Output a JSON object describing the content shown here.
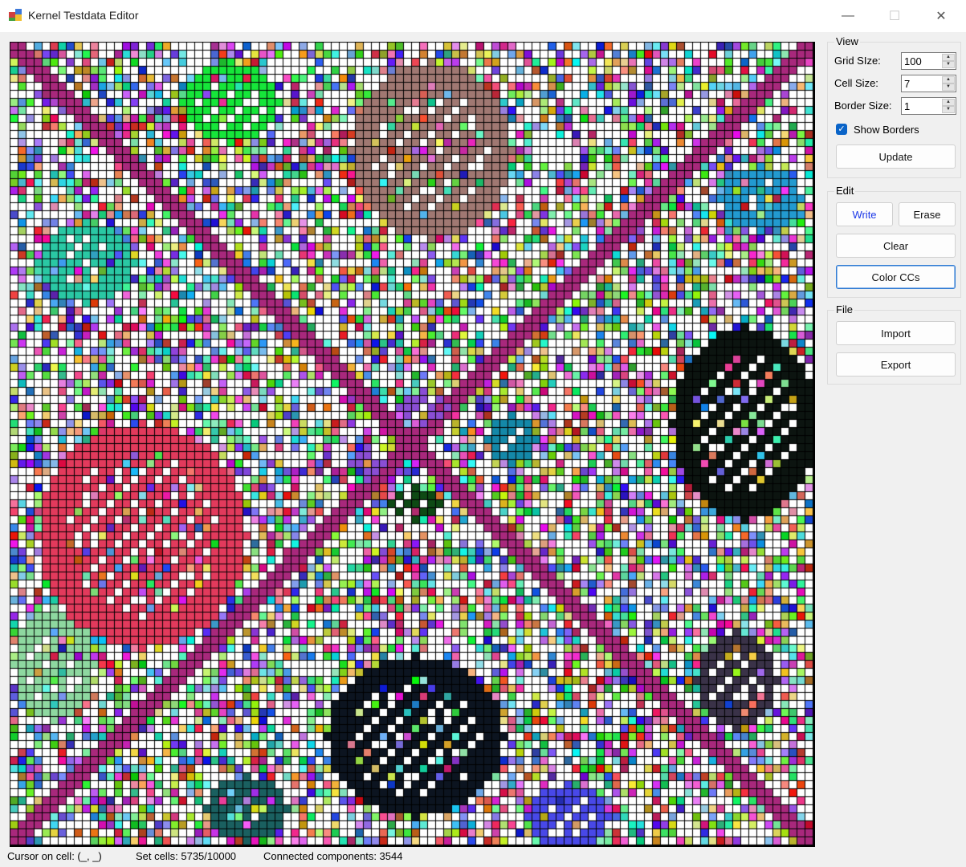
{
  "window": {
    "title": "Kernel Testdata Editor",
    "controls": {
      "minimize": "—",
      "maximize": "☐",
      "close": "✕"
    }
  },
  "view": {
    "group_label": "View",
    "grid_size_label": "Grid SIze:",
    "grid_size_value": "100",
    "cell_size_label": "Cell Size:",
    "cell_size_value": "7",
    "border_size_label": "Border Size:",
    "border_size_value": "1",
    "show_borders_label": "Show Borders",
    "show_borders_checked": true,
    "update_label": "Update"
  },
  "edit": {
    "group_label": "Edit",
    "write_label": "Write",
    "erase_label": "Erase",
    "clear_label": "Clear",
    "color_ccs_label": "Color CCs",
    "active_mode": "Write"
  },
  "file": {
    "group_label": "File",
    "import_label": "Import",
    "export_label": "Export"
  },
  "grid": {
    "cells_per_side": 100,
    "set_cells": 5735,
    "total_cells": 10000,
    "pattern_colors": {
      "diagonal": "#a8287c",
      "pink_blob": "#e23a5c",
      "rose_blob": "#a07872",
      "black_blob": "#0c1410",
      "navy_blob": "#0c1420",
      "green_blob": "#16e63a",
      "teal_blob": "#2ac8a4",
      "blue_blob": "#229ad0",
      "mint_blob": "#8ed8a0",
      "purple_blob": "#3a3248",
      "cyan_blob": "#1488a8",
      "violet_blob": "#8a4ed4",
      "dark_green_blob": "#0e4a14",
      "indigo_blob": "#4848e8",
      "teal_dark_blob": "#1a6060"
    },
    "empty_color": "#ffffff",
    "border_color": "#000000"
  },
  "status": {
    "cursor": "Cursor on cell: (_, _)",
    "set_cells": "Set cells: 5735/10000",
    "components": "Connected components: 3544"
  }
}
